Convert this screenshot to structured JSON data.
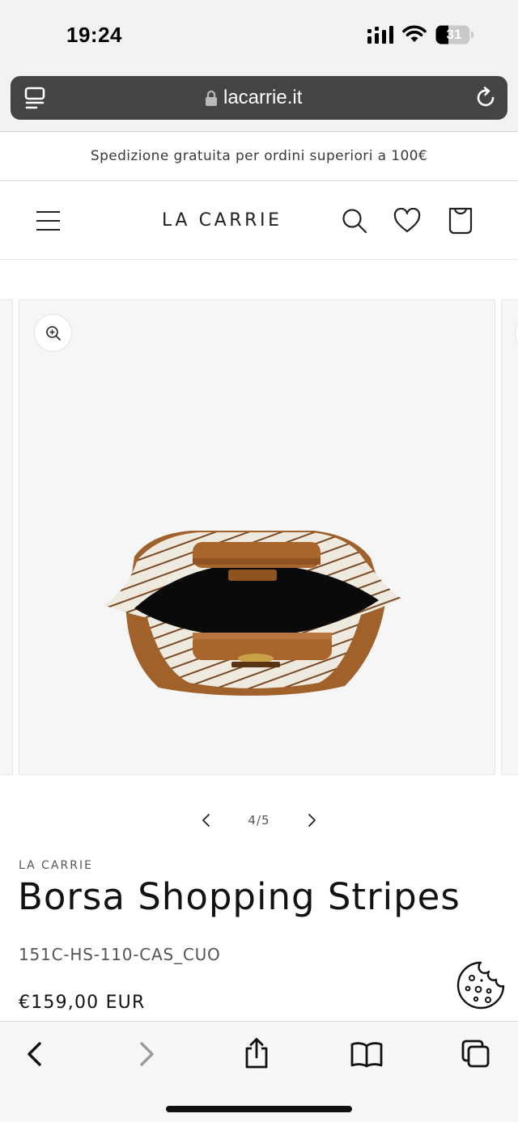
{
  "status_bar": {
    "time": "19:24",
    "battery_level": "31",
    "icons": [
      "signal-icon",
      "wifi-icon",
      "battery-icon"
    ]
  },
  "browser": {
    "url": "lacarrie.it",
    "icons": [
      "reader-icon",
      "lock-icon",
      "reload-icon"
    ]
  },
  "announcement": {
    "text": "Spedizione gratuita per ordini superiori a 100€"
  },
  "header": {
    "logo": "LA CARRIE",
    "icons": [
      "menu-icon",
      "search-icon",
      "heart-icon",
      "bag-icon"
    ]
  },
  "gallery": {
    "counter": "4/5",
    "current_slide": 4,
    "total_slides": 5,
    "icons": [
      "zoom-in-icon",
      "chevron-left-icon",
      "chevron-right-icon"
    ]
  },
  "product": {
    "vendor": "LA CARRIE",
    "title": "Borsa Shopping Stripes",
    "sku": "151C-HS-110-CAS_CUO",
    "price": "€159,00 EUR"
  },
  "toolbar": {
    "icons": [
      "back-icon",
      "forward-icon",
      "share-icon",
      "bookmarks-icon",
      "tabs-icon"
    ]
  },
  "colors": {
    "url_bar": "#444444",
    "chrome_bg": "#f2f2f2",
    "gallery_bg": "#f6f6f6",
    "leather": "#a0612b",
    "text": "#121212"
  }
}
